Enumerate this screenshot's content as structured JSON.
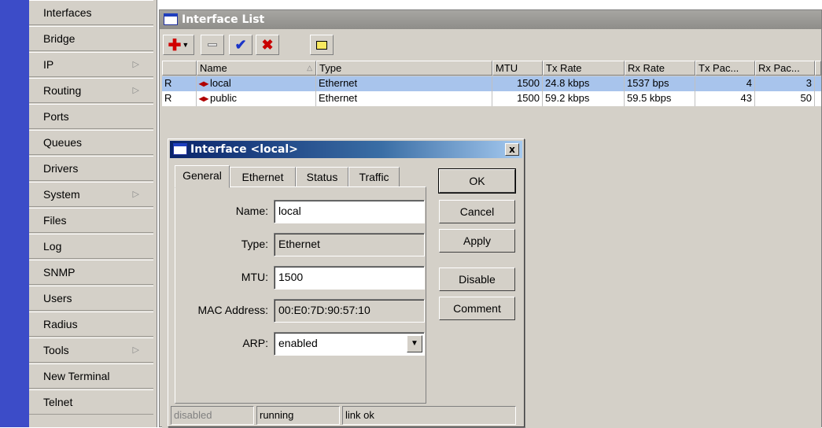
{
  "sidebar": {
    "items": [
      {
        "label": "Interfaces",
        "submenu": false
      },
      {
        "label": "Bridge",
        "submenu": false
      },
      {
        "label": "IP",
        "submenu": true
      },
      {
        "label": "Routing",
        "submenu": true
      },
      {
        "label": "Ports",
        "submenu": false
      },
      {
        "label": "Queues",
        "submenu": false
      },
      {
        "label": "Drivers",
        "submenu": false
      },
      {
        "label": "System",
        "submenu": true
      },
      {
        "label": "Files",
        "submenu": false
      },
      {
        "label": "Log",
        "submenu": false
      },
      {
        "label": "SNMP",
        "submenu": false
      },
      {
        "label": "Users",
        "submenu": false
      },
      {
        "label": "Radius",
        "submenu": false
      },
      {
        "label": "Tools",
        "submenu": true
      },
      {
        "label": "New Terminal",
        "submenu": false
      },
      {
        "label": "Telnet",
        "submenu": false
      }
    ]
  },
  "list_window": {
    "title": "Interface List",
    "toolbar": {
      "add_icon": "plus-icon",
      "remove_icon": "minus-icon",
      "enable_icon": "checkmark-icon",
      "disable_icon": "cross-icon",
      "comment_icon": "note-icon"
    },
    "columns": [
      "",
      "Name",
      "Type",
      "MTU",
      "Tx Rate",
      "Rx Rate",
      "Tx Pac...",
      "Rx Pac..."
    ],
    "rows": [
      {
        "flag": "R",
        "name": "local",
        "type": "Ethernet",
        "mtu": "1500",
        "tx_rate": "24.8 kbps",
        "rx_rate": "1537 bps",
        "tx_pac": "4",
        "rx_pac": "3",
        "selected": true
      },
      {
        "flag": "R",
        "name": "public",
        "type": "Ethernet",
        "mtu": "1500",
        "tx_rate": "59.2 kbps",
        "rx_rate": "59.5 kbps",
        "tx_pac": "43",
        "rx_pac": "50",
        "selected": false
      }
    ]
  },
  "dialog": {
    "title": "Interface <local>",
    "close_label": "x",
    "tabs": [
      "General",
      "Ethernet",
      "Status",
      "Traffic"
    ],
    "active_tab": "General",
    "fields": {
      "name": {
        "label": "Name:",
        "value": "local"
      },
      "type": {
        "label": "Type:",
        "value": "Ethernet"
      },
      "mtu": {
        "label": "MTU:",
        "value": "1500"
      },
      "mac": {
        "label": "MAC Address:",
        "value": "00:E0:7D:90:57:10"
      },
      "arp": {
        "label": "ARP:",
        "value": "enabled"
      }
    },
    "buttons": {
      "ok": "OK",
      "cancel": "Cancel",
      "apply": "Apply",
      "disable": "Disable",
      "comment": "Comment"
    },
    "status": {
      "enabled_state": "disabled",
      "running": "running",
      "link": "link ok"
    }
  },
  "colors": {
    "sidebar_strip": "#3c4cc8",
    "selection": "#a8c4ec",
    "dialog_title": "#0a246a"
  }
}
